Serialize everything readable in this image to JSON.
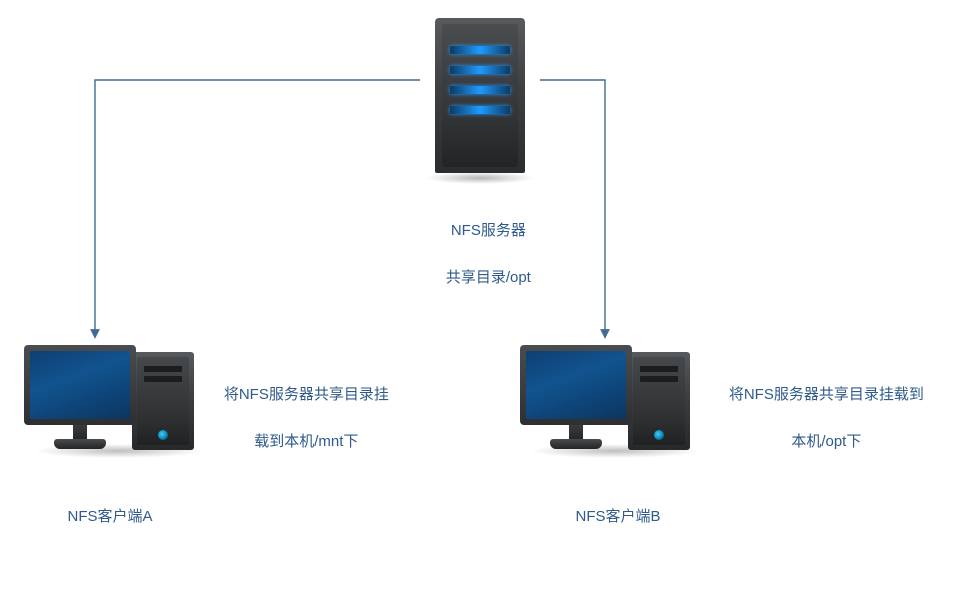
{
  "server": {
    "label_line1": "NFS服务器",
    "label_line2": "共享目录/opt"
  },
  "clientA": {
    "name": "NFS客户端A",
    "desc_line1": "将NFS服务器共享目录挂",
    "desc_line2": "载到本机/mnt下"
  },
  "clientB": {
    "name": "NFS客户端B",
    "desc_line1": "将NFS服务器共享目录挂载到",
    "desc_line2": "本机/opt下"
  },
  "colors": {
    "line": "#3f6c95"
  }
}
